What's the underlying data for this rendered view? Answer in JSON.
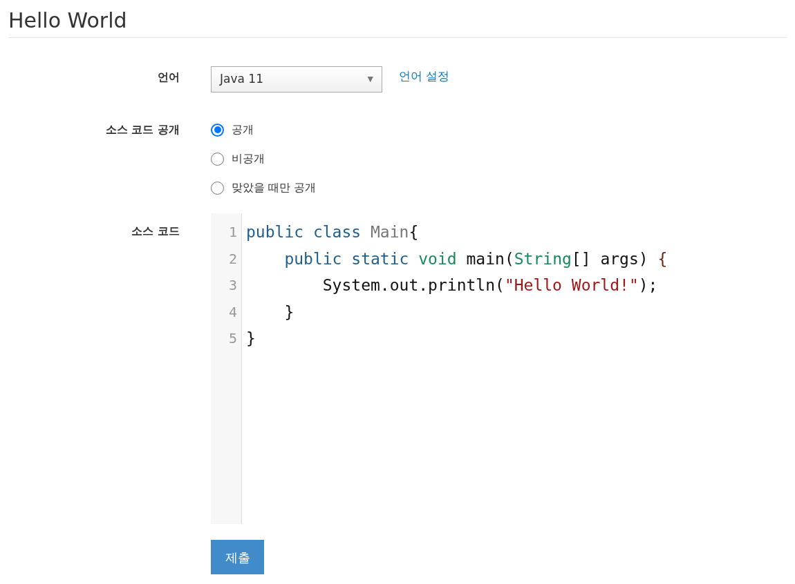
{
  "title": "Hello World",
  "language": {
    "label": "언어",
    "value": "Java 11",
    "caret": "▼",
    "settings_link": "언어 설정"
  },
  "visibility": {
    "label": "소스 코드 공개",
    "options": [
      {
        "label": "공개",
        "selected": true
      },
      {
        "label": "비공개",
        "selected": false
      },
      {
        "label": "맞았을 때만 공개",
        "selected": false
      }
    ]
  },
  "source": {
    "label": "소스 코드",
    "lines": [
      {
        "number": "1",
        "tokens": [
          {
            "kind": "keyword",
            "text": "public class"
          },
          {
            "kind": "name",
            "text": " Main"
          },
          {
            "kind": "plain",
            "text": "{"
          }
        ]
      },
      {
        "number": "2",
        "tokens": [
          {
            "kind": "keyword",
            "text": "    public static"
          },
          {
            "kind": "type",
            "text": " void"
          },
          {
            "kind": "plain",
            "text": " main("
          },
          {
            "kind": "type",
            "text": "String"
          },
          {
            "kind": "plain",
            "text": "[] args) "
          },
          {
            "kind": "bracket",
            "text": "{"
          }
        ]
      },
      {
        "number": "3",
        "tokens": [
          {
            "kind": "plain",
            "text": "        System.out.println("
          },
          {
            "kind": "string",
            "text": "\"Hello World!\""
          },
          {
            "kind": "plain",
            "text": ");"
          }
        ]
      },
      {
        "number": "4",
        "tokens": [
          {
            "kind": "plain",
            "text": "    }"
          }
        ]
      },
      {
        "number": "5",
        "tokens": [
          {
            "kind": "plain",
            "text": "}"
          }
        ]
      }
    ]
  },
  "submit": "제출"
}
